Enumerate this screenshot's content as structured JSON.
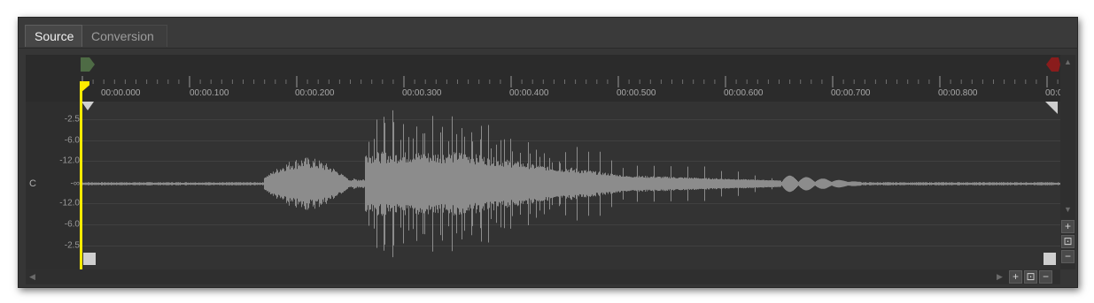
{
  "tabs": [
    {
      "label": "Source",
      "active": true
    },
    {
      "label": "Conversion",
      "active": false
    }
  ],
  "ruler": {
    "labels": [
      "00:00.000",
      "00:00.100",
      "00:00.200",
      "00:00.300",
      "00:00.400",
      "00:00.500",
      "00:00.600",
      "00:00.700",
      "00:00.800",
      "00:0"
    ]
  },
  "channel": {
    "label": "C"
  },
  "yaxis": {
    "labels": [
      "-2.5",
      "-6.0",
      "-12.0",
      "-∞",
      "-12.0",
      "-6.0",
      "-2.5"
    ]
  },
  "markers": {
    "start_color": "#4e6b45",
    "end_color": "#8a1c1c"
  },
  "colors": {
    "playhead": "#ffeb00",
    "waveform": "#8c8c8c",
    "background": "#333333"
  },
  "zoom_buttons": {
    "zoom_in": "+",
    "zoom_fit": "⊡",
    "zoom_out": "−"
  }
}
